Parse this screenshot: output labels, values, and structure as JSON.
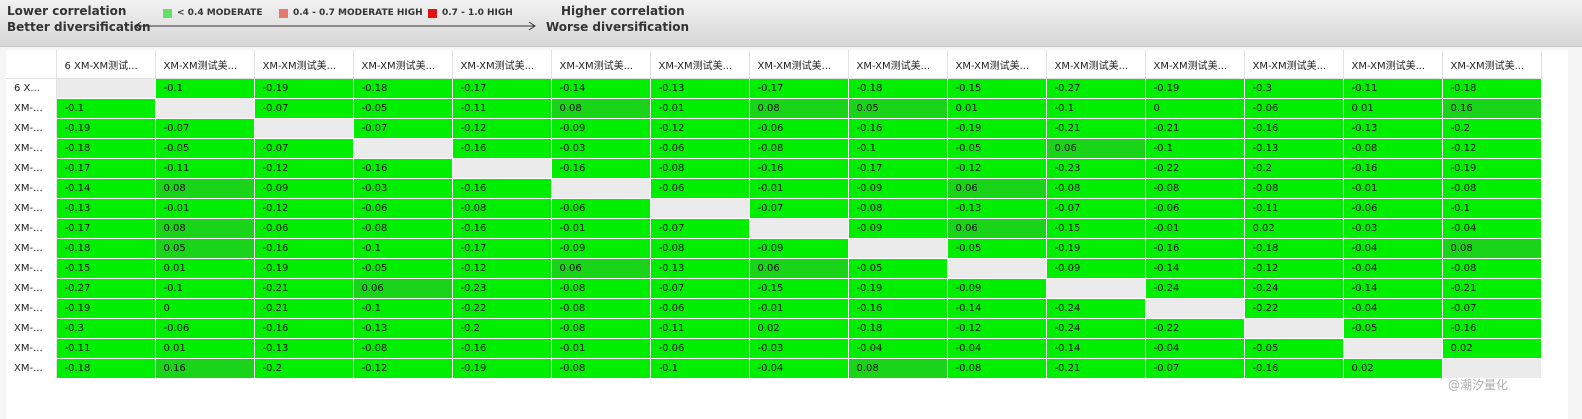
{
  "header": {
    "lower_line1": "Lower correlation",
    "lower_line2": "Better diversification",
    "higher_line1": "Higher correlation",
    "higher_line2": "Worse diversification",
    "legend": [
      {
        "label": "< 0.4 MODERATE",
        "color": "#66dd66"
      },
      {
        "label": "0.4 - 0.7 MODERATE HIGH",
        "color": "#e77a6e"
      },
      {
        "label": "0.7 - 1.0 HIGH",
        "color": "#e11111"
      }
    ]
  },
  "matrix": {
    "corner": "",
    "columns": [
      "6 XM-XM测试...",
      "XM-XM测试美...",
      "XM-XM测试美...",
      "XM-XM测试美...",
      "XM-XM测试美...",
      "XM-XM测试美...",
      "XM-XM测试美...",
      "XM-XM测试美...",
      "XM-XM测试美...",
      "XM-XM测试美...",
      "XM-XM测试美...",
      "XM-XM测试美...",
      "XM-XM测试美...",
      "XM-XM测试美...",
      "XM-XM测试美..."
    ],
    "row_labels": [
      "6 X...",
      "XM-...",
      "XM-...",
      "XM-...",
      "XM-...",
      "XM-...",
      "XM-...",
      "XM-...",
      "XM-...",
      "XM-...",
      "XM-...",
      "XM-...",
      "XM-...",
      "XM-...",
      "XM-..."
    ],
    "values": [
      [
        "",
        "-0.1",
        "-0.19",
        "-0.18",
        "-0.17",
        "-0.14",
        "-0.13",
        "-0.17",
        "-0.18",
        "-0.15",
        "-0.27",
        "-0.19",
        "-0.3",
        "-0.11",
        "-0.18"
      ],
      [
        "-0.1",
        "",
        "-0.07",
        "-0.05",
        "-0.11",
        "0.08",
        "-0.01",
        "0.08",
        "0.05",
        "0.01",
        "-0.1",
        "0",
        "-0.06",
        "0.01",
        "0.16"
      ],
      [
        "-0.19",
        "-0.07",
        "",
        "-0.07",
        "-0.12",
        "-0.09",
        "-0.12",
        "-0.06",
        "-0.16",
        "-0.19",
        "-0.21",
        "-0.21",
        "-0.16",
        "-0.13",
        "-0.2"
      ],
      [
        "-0.18",
        "-0.05",
        "-0.07",
        "",
        "-0.16",
        "-0.03",
        "-0.06",
        "-0.08",
        "-0.1",
        "-0.05",
        "0.06",
        "-0.1",
        "-0.13",
        "-0.08",
        "-0.12"
      ],
      [
        "-0.17",
        "-0.11",
        "-0.12",
        "-0.16",
        "",
        "-0.16",
        "-0.08",
        "-0.16",
        "-0.17",
        "-0.12",
        "-0.23",
        "-0.22",
        "-0.2",
        "-0.16",
        "-0.19"
      ],
      [
        "-0.14",
        "0.08",
        "-0.09",
        "-0.03",
        "-0.16",
        "",
        "-0.06",
        "-0.01",
        "-0.09",
        "0.06",
        "-0.08",
        "-0.08",
        "-0.08",
        "-0.01",
        "-0.08"
      ],
      [
        "-0.13",
        "-0.01",
        "-0.12",
        "-0.06",
        "-0.08",
        "-0.06",
        "",
        "-0.07",
        "-0.08",
        "-0.13",
        "-0.07",
        "-0.06",
        "-0.11",
        "-0.06",
        "-0.1"
      ],
      [
        "-0.17",
        "0.08",
        "-0.06",
        "-0.08",
        "-0.16",
        "-0.01",
        "-0.07",
        "",
        "-0.09",
        "0.06",
        "-0.15",
        "-0.01",
        "0.02",
        "-0.03",
        "-0.04"
      ],
      [
        "-0.18",
        "0.05",
        "-0.16",
        "-0.1",
        "-0.17",
        "-0.09",
        "-0.08",
        "-0.09",
        "",
        "-0.05",
        "-0.19",
        "-0.16",
        "-0.18",
        "-0.04",
        "0.08"
      ],
      [
        "-0.15",
        "0.01",
        "-0.19",
        "-0.05",
        "-0.12",
        "0.06",
        "-0.13",
        "0.06",
        "-0.05",
        "",
        "-0.09",
        "-0.14",
        "-0.12",
        "-0.04",
        "-0.08"
      ],
      [
        "-0.27",
        "-0.1",
        "-0.21",
        "0.06",
        "-0.23",
        "-0.08",
        "-0.07",
        "-0.15",
        "-0.19",
        "-0.09",
        "",
        "-0.24",
        "-0.24",
        "-0.14",
        "-0.21"
      ],
      [
        "-0.19",
        "0",
        "-0.21",
        "-0.1",
        "-0.22",
        "-0.08",
        "-0.06",
        "-0.01",
        "-0.16",
        "-0.14",
        "-0.24",
        "",
        "-0.22",
        "-0.04",
        "-0.07"
      ],
      [
        "-0.3",
        "-0.06",
        "-0.16",
        "-0.13",
        "-0.2",
        "-0.08",
        "-0.11",
        "0.02",
        "-0.18",
        "-0.12",
        "-0.24",
        "-0.22",
        "",
        "-0.05",
        "-0.16"
      ],
      [
        "-0.11",
        "0.01",
        "-0.13",
        "-0.08",
        "-0.16",
        "-0.01",
        "-0.06",
        "-0.03",
        "-0.04",
        "-0.04",
        "-0.14",
        "-0.04",
        "-0.05",
        "",
        "0.02"
      ],
      [
        "-0.18",
        "0.16",
        "-0.2",
        "-0.12",
        "-0.19",
        "-0.08",
        "-0.1",
        "-0.04",
        "0.08",
        "-0.08",
        "-0.21",
        "-0.07",
        "-0.16",
        "0.02",
        ""
      ]
    ]
  },
  "watermark": "@潮汐量化",
  "colors": {
    "moderate_cell": "#00ee00",
    "positive_cell": "#19d419",
    "diagonal": "#ebebeb"
  }
}
